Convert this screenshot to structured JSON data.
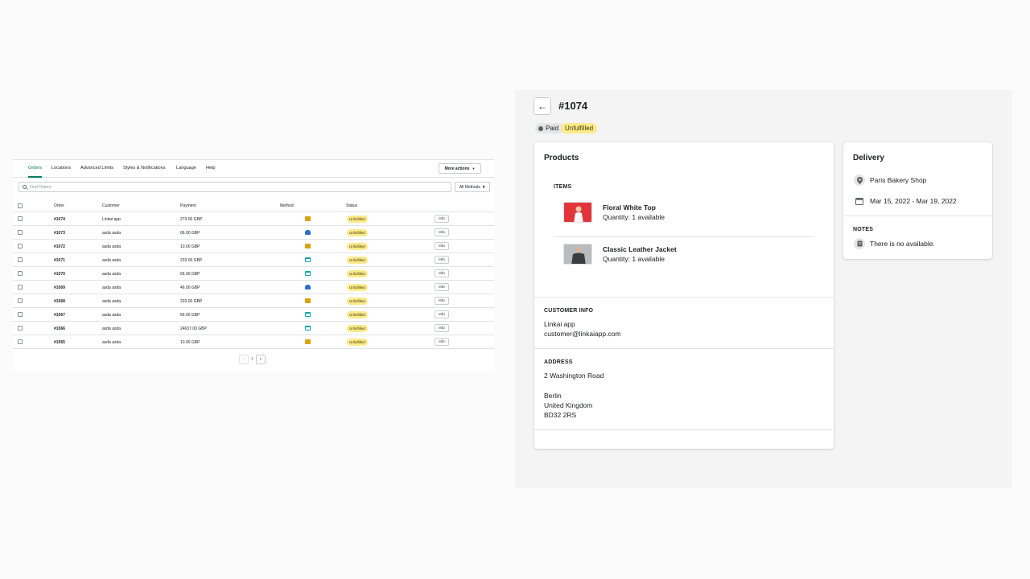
{
  "orders_view": {
    "tabs": [
      "Orders",
      "Locations",
      "Advanced Limits",
      "Styles & Notifications",
      "Language",
      "Help"
    ],
    "more_actions_label": "More actions",
    "search_placeholder": "Find Orders",
    "methods_filter": "All Methods",
    "columns": [
      "Order",
      "Customer",
      "Payment",
      "Method",
      "Status"
    ],
    "rows": [
      {
        "order": "#1074",
        "customer": "Linkai app",
        "payment": "273.00 GBP",
        "method": "truck-icon",
        "status": "Unfulfilled",
        "action": "Info"
      },
      {
        "order": "#1073",
        "customer": "asda asda",
        "payment": "66.00 GBP",
        "method": "car-icon",
        "status": "Unfulfilled",
        "action": "Info"
      },
      {
        "order": "#1072",
        "customer": "asda asda",
        "payment": "10.00 GBP",
        "method": "truck-icon",
        "status": "Unfulfilled",
        "action": "Info"
      },
      {
        "order": "#1071",
        "customer": "asda asda",
        "payment": "233.00 GBP",
        "method": "store-icon",
        "status": "Unfulfilled",
        "action": "Info"
      },
      {
        "order": "#1070",
        "customer": "asda asda",
        "payment": "66.00 GBP",
        "method": "store-icon",
        "status": "Unfulfilled",
        "action": "Info"
      },
      {
        "order": "#1069",
        "customer": "asda asda",
        "payment": "46.00 GBP",
        "method": "car-icon",
        "status": "Unfulfilled",
        "action": "Info"
      },
      {
        "order": "#1068",
        "customer": "asda asda",
        "payment": "233.00 GBP",
        "method": "truck-icon",
        "status": "Unfulfilled",
        "action": "Info"
      },
      {
        "order": "#1067",
        "customer": "asda asda",
        "payment": "66.00 GBP",
        "method": "store-icon",
        "status": "Unfulfilled",
        "action": "Info"
      },
      {
        "order": "#1066",
        "customer": "asda asda",
        "payment": "24637.00 GBP",
        "method": "store-icon",
        "status": "Unfulfilled",
        "action": "Info"
      },
      {
        "order": "#1065",
        "customer": "asda asda",
        "payment": "10.00 GBP",
        "method": "truck-icon",
        "status": "Unfulfilled",
        "action": "Info"
      }
    ],
    "pagination": {
      "current_page": "1",
      "prev_icon": "chevron-left-icon",
      "next_icon": "chevron-right-icon"
    }
  },
  "order_detail": {
    "back_icon": "arrow-left-icon",
    "title": "#1074",
    "payment_badge": "Paid",
    "fulfillment_badge": "Unfulfilled",
    "products": {
      "heading": "Products",
      "items_label": "ITEMS",
      "items": [
        {
          "name": "Floral White Top",
          "quantity": "Quantity: 1 available",
          "thumb_color": "#e2353b"
        },
        {
          "name": "Classic Leather Jacket",
          "quantity": "Quantity: 1 available",
          "thumb_color": "#4a4d50"
        }
      ]
    },
    "customer_info": {
      "label": "CUSTOMER INFO",
      "name": "Linkai app",
      "email": "customer@linkaiapp.com"
    },
    "address": {
      "label": "ADDRESS",
      "line1": "2 Washington Road",
      "city": "Berlin",
      "country": "United Kingdom",
      "postcode": "BD32 2RS"
    },
    "delivery": {
      "heading": "Delivery",
      "location_icon": "map-pin-icon",
      "location": "Paris Bakery Shop",
      "calendar_icon": "calendar-icon",
      "dates": "Mar 15, 2022 - Mar 19, 2022",
      "notes_label": "NOTES",
      "notes_icon": "note-icon",
      "notes": "There is no available."
    }
  },
  "colors": {
    "accent": "#008060",
    "warning_badge": "#ffea8a",
    "panel_bg": "#f4f4f4"
  }
}
